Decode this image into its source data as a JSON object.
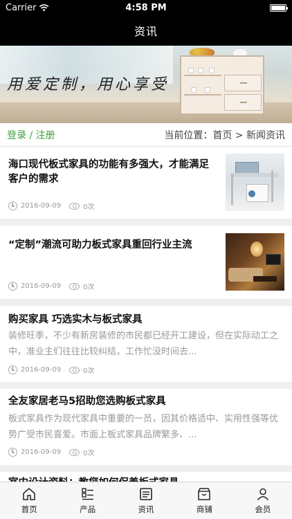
{
  "status_bar": {
    "carrier": "Carrier",
    "time": "4:58 PM"
  },
  "nav": {
    "title": "资讯"
  },
  "banner": {
    "slogan": "用爱定制，用心享受"
  },
  "breadcrumb": {
    "login": "登录 / 注册",
    "location": "当前位置：首页 > 新闻资讯"
  },
  "articles": [
    {
      "title": "海口现代板式家具的功能有多强大，才能满足客户的需求",
      "summary": "",
      "date": "2016-09-09",
      "views": "0次",
      "has_thumbnail": true
    },
    {
      "title": "“定制”潮流可助力板式家具重回行业主流",
      "summary": "",
      "date": "2016-09-09",
      "views": "0次",
      "has_thumbnail": true
    },
    {
      "title": "购买家具 巧选实木与板式家具",
      "summary": "装修旺季，不少有新房装修的市民都已经开工建设，但在实际动工之中，准业主们往往比较纠结，工作忙没时间去...",
      "date": "2016-09-09",
      "views": "0次",
      "has_thumbnail": false
    },
    {
      "title": "全友家居老马5招助您选购板式家具",
      "summary": "板式家具作为现代家具中重要的一员，因其价格适中、实用性强等优势广受市民喜爱。市面上板式家具品牌繁多、...",
      "date": "2016-09-09",
      "views": "0次",
      "has_thumbnail": false
    },
    {
      "title": "室内设计资料：教您如何保养板式家具",
      "summary": "",
      "date": "",
      "views": "",
      "has_thumbnail": false
    }
  ],
  "tabbar": {
    "items": [
      {
        "label": "首页",
        "icon": "home-icon"
      },
      {
        "label": "产品",
        "icon": "product-list-icon"
      },
      {
        "label": "资讯",
        "icon": "news-icon",
        "active": true
      },
      {
        "label": "商铺",
        "icon": "store-icon"
      },
      {
        "label": "会员",
        "icon": "member-icon"
      }
    ]
  }
}
